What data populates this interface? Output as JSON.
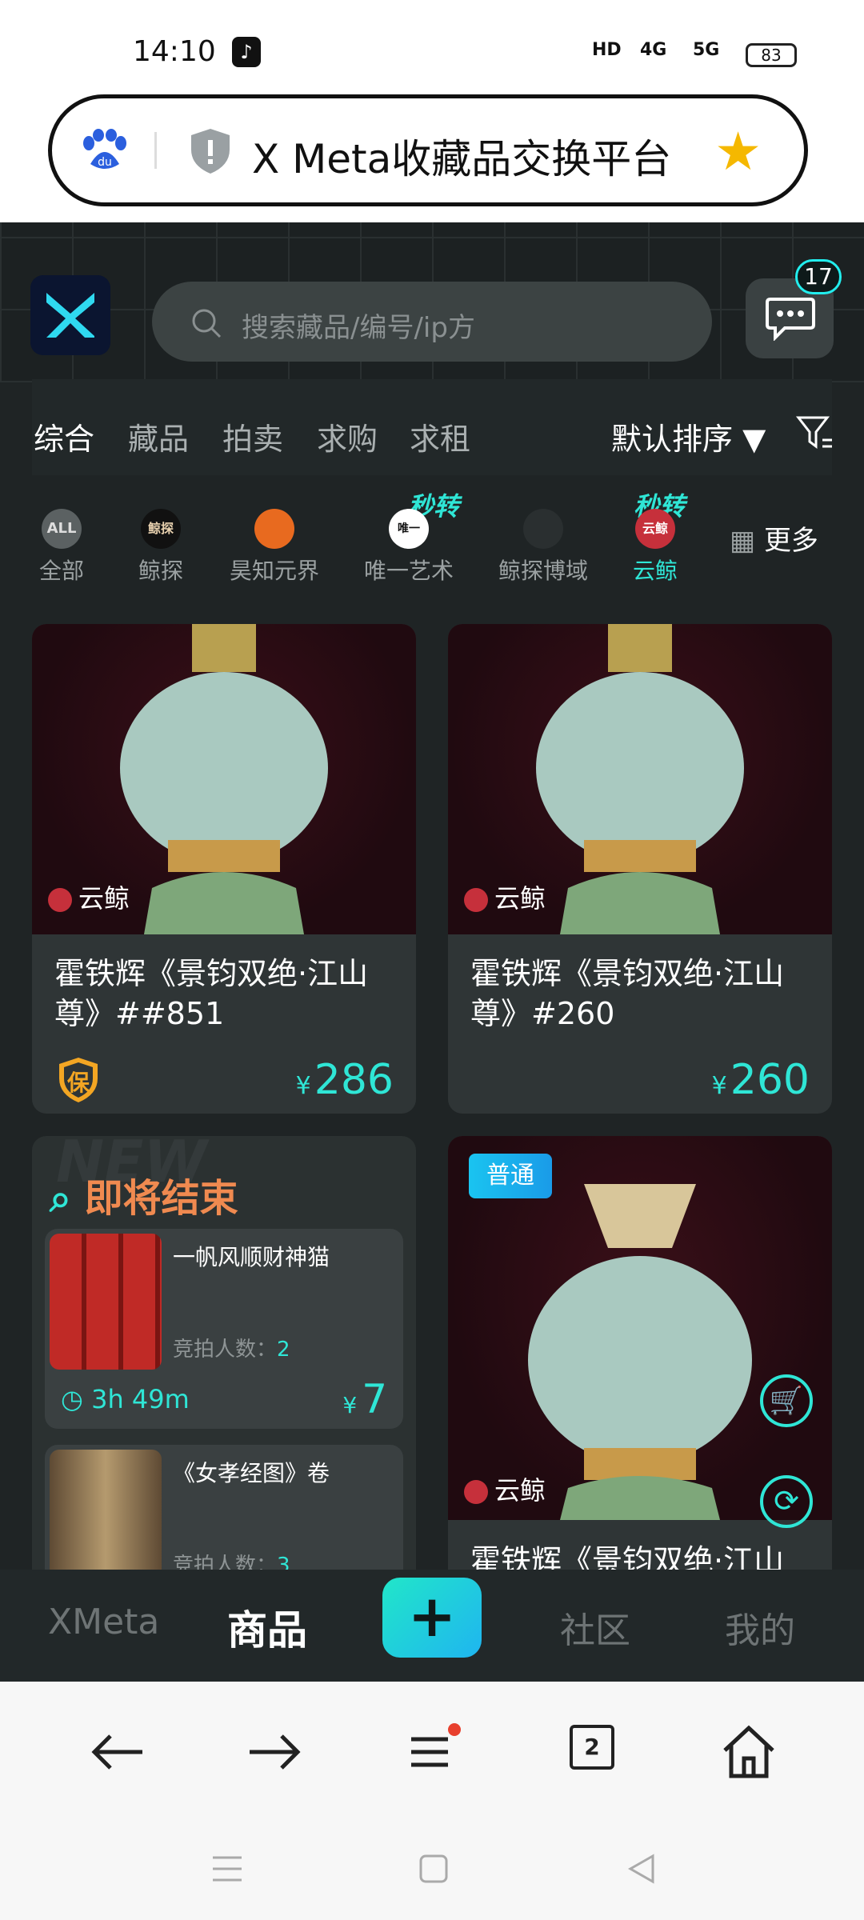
{
  "status": {
    "time": "14:10",
    "hd": "HD",
    "net1": "4G",
    "net2": "5G",
    "battery": "83"
  },
  "browser": {
    "title": "X Meta收藏品交换平台",
    "tab_count": "2"
  },
  "app": {
    "search_placeholder": "搜索藏品/编号/ip方",
    "message_badge": "17",
    "tabs": [
      "综合",
      "藏品",
      "拍卖",
      "求购",
      "求租"
    ],
    "sort_label": "默认排序",
    "brands": [
      {
        "label": "全部",
        "icon_text": "ALL"
      },
      {
        "label": "鲸探",
        "icon_text": "鲸探"
      },
      {
        "label": "昊知元界",
        "icon_text": ""
      },
      {
        "label": "唯一艺术",
        "icon_text": "唯一"
      },
      {
        "label": "鲸探博域",
        "icon_text": ""
      },
      {
        "label": "云鲸",
        "icon_text": "云鲸"
      }
    ],
    "seckill_label": "秒转",
    "more_label": "更多",
    "cards": [
      {
        "platform": "云鲸",
        "title": "霍铁辉《景钧双绝·江山尊》##851",
        "currency": "¥",
        "price": "286",
        "guarantee": "保"
      },
      {
        "platform": "云鲸",
        "title": "霍铁辉《景钧双绝·江山尊》#260",
        "currency": "¥",
        "price": "260"
      },
      {
        "platform": "云鲸",
        "badge": "普通",
        "title": "霍铁辉《景钧双绝·江山"
      }
    ],
    "ending": {
      "title": "即将结束",
      "watermark": "NEW",
      "items": [
        {
          "name": "一帆风顺财神猫",
          "bid_label": "竞拍人数：",
          "bid_count": "2",
          "timer": "3h 49m",
          "currency": "¥",
          "price": "7"
        },
        {
          "name": "《女孝经图》卷",
          "bid_label": "竞拍人数：",
          "bid_count": "3"
        }
      ]
    },
    "nav": {
      "xmeta": "XMeta",
      "goods": "商品",
      "plus": "+",
      "community": "社区",
      "mine": "我的"
    }
  },
  "colors": {
    "accent": "#2fe6d6",
    "background": "#1f2425",
    "card": "#2f3536"
  }
}
